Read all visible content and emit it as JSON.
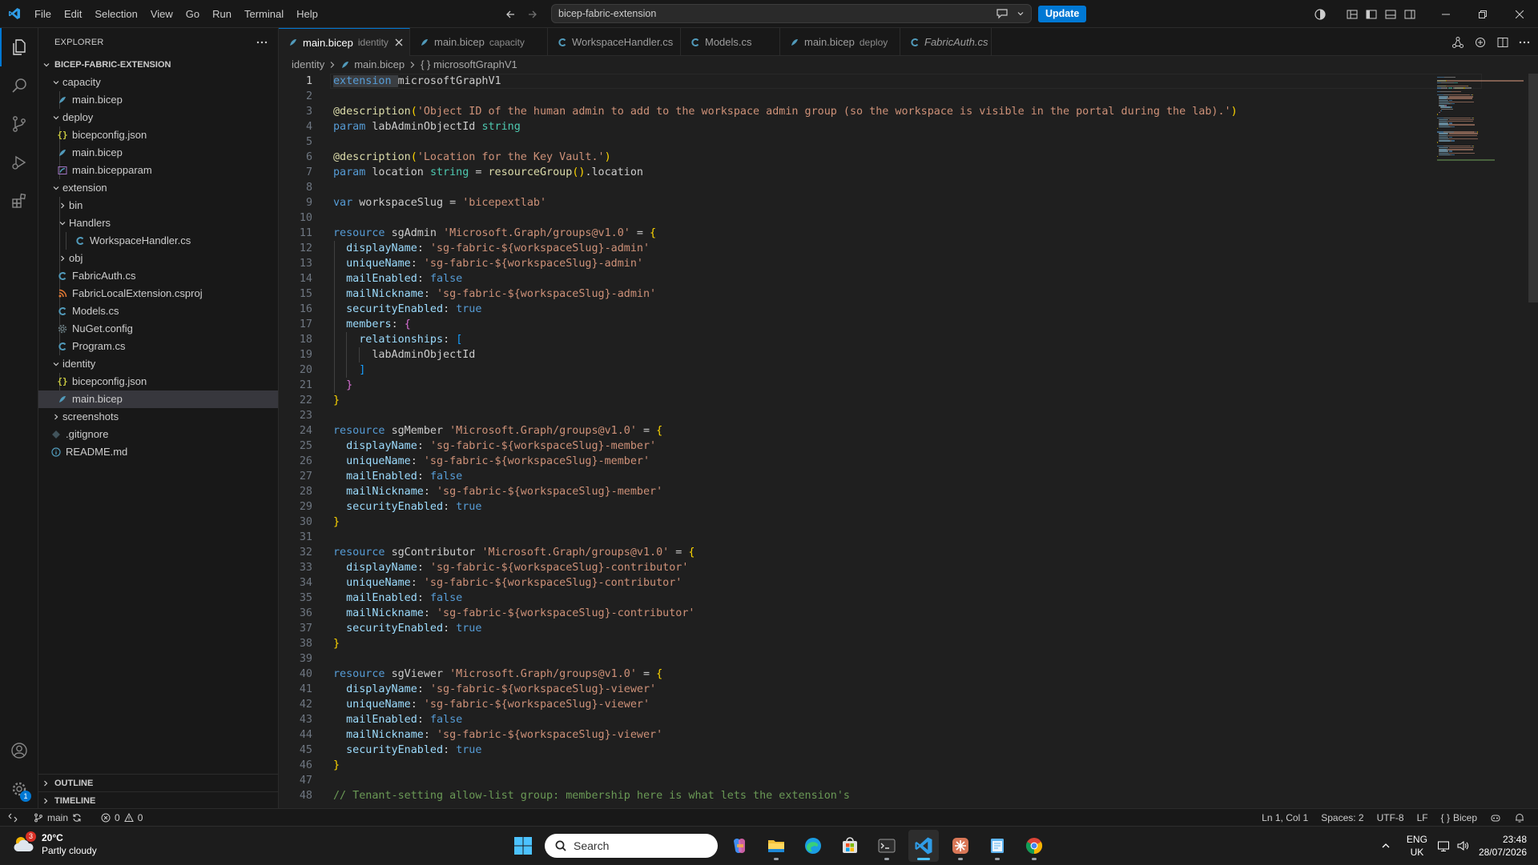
{
  "menu": [
    "File",
    "Edit",
    "Selection",
    "View",
    "Go",
    "Run",
    "Terminal",
    "Help"
  ],
  "command_center": {
    "text": "bicep-fabric-extension"
  },
  "update_label": "Update",
  "explorer": {
    "title": "EXPLORER",
    "root": "BICEP-FABRIC-EXTENSION",
    "items": [
      {
        "label": "capacity",
        "kind": "folder-open"
      },
      {
        "label": "main.bicep",
        "kind": "bicep"
      },
      {
        "label": "deploy",
        "kind": "folder-open"
      },
      {
        "label": "bicepconfig.json",
        "kind": "json"
      },
      {
        "label": "main.bicep",
        "kind": "bicep"
      },
      {
        "label": "main.bicepparam",
        "kind": "bicepparam"
      },
      {
        "label": "extension",
        "kind": "folder-open"
      },
      {
        "label": "bin",
        "kind": "folder-closed"
      },
      {
        "label": "Handlers",
        "kind": "folder-open"
      },
      {
        "label": "WorkspaceHandler.cs",
        "kind": "cs"
      },
      {
        "label": "obj",
        "kind": "folder-closed"
      },
      {
        "label": "FabricAuth.cs",
        "kind": "cs"
      },
      {
        "label": "FabricLocalExtension.csproj",
        "kind": "csproj"
      },
      {
        "label": "Models.cs",
        "kind": "cs"
      },
      {
        "label": "NuGet.config",
        "kind": "config"
      },
      {
        "label": "Program.cs",
        "kind": "cs"
      },
      {
        "label": "identity",
        "kind": "folder-open"
      },
      {
        "label": "bicepconfig.json",
        "kind": "json"
      },
      {
        "label": "main.bicep",
        "kind": "bicep"
      },
      {
        "label": "screenshots",
        "kind": "folder-closed"
      },
      {
        "label": ".gitignore",
        "kind": "gitignore"
      },
      {
        "label": "README.md",
        "kind": "md"
      }
    ],
    "outline": "OUTLINE",
    "timeline": "TIMELINE"
  },
  "tabs": [
    {
      "name": "main.bicep",
      "desc": "identity"
    },
    {
      "name": "main.bicep",
      "desc": "capacity"
    },
    {
      "name": "WorkspaceHandler.cs",
      "desc": ""
    },
    {
      "name": "Models.cs",
      "desc": ""
    },
    {
      "name": "main.bicep",
      "desc": "deploy"
    },
    {
      "name": "FabricAuth.cs",
      "desc": ""
    }
  ],
  "breadcrumb": [
    "identity",
    "main.bicep",
    "{ } microsoftGraphV1"
  ],
  "editor": {
    "current_line": 1,
    "lines": [
      [
        [
          "kw",
          "extension "
        ],
        [
          "plain",
          "microsoftGraphV1"
        ]
      ],
      [],
      [
        [
          "fn",
          "@description"
        ],
        [
          "br1",
          "("
        ],
        [
          "str",
          "'Object ID of the human admin to add to the workspace admin group (so the workspace is visible in the portal during the lab).'"
        ],
        [
          "br1",
          ")"
        ]
      ],
      [
        [
          "kw",
          "param "
        ],
        [
          "plain",
          "labAdminObjectId "
        ],
        [
          "ty",
          "string"
        ]
      ],
      [],
      [
        [
          "fn",
          "@description"
        ],
        [
          "br1",
          "("
        ],
        [
          "str",
          "'Location for the Key Vault.'"
        ],
        [
          "br1",
          ")"
        ]
      ],
      [
        [
          "kw",
          "param "
        ],
        [
          "plain",
          "location "
        ],
        [
          "ty",
          "string"
        ],
        [
          "plain",
          " = "
        ],
        [
          "fn",
          "resourceGroup"
        ],
        [
          "br1",
          "()"
        ],
        [
          "plain",
          ".location"
        ]
      ],
      [],
      [
        [
          "kw",
          "var "
        ],
        [
          "plain",
          "workspaceSlug = "
        ],
        [
          "str",
          "'bicepextlab'"
        ]
      ],
      [],
      [
        [
          "kw",
          "resource "
        ],
        [
          "plain",
          "sgAdmin "
        ],
        [
          "str",
          "'Microsoft.Graph/groups@v1.0'"
        ],
        [
          "plain",
          " = "
        ],
        [
          "br1",
          "{"
        ]
      ],
      [
        [
          "plain",
          "  "
        ],
        [
          "prop",
          "displayName"
        ],
        [
          "plain",
          ": "
        ],
        [
          "str",
          "'sg-fabric-${workspaceSlug}-admin'"
        ]
      ],
      [
        [
          "plain",
          "  "
        ],
        [
          "prop",
          "uniqueName"
        ],
        [
          "plain",
          ": "
        ],
        [
          "str",
          "'sg-fabric-${workspaceSlug}-admin'"
        ]
      ],
      [
        [
          "plain",
          "  "
        ],
        [
          "prop",
          "mailEnabled"
        ],
        [
          "plain",
          ": "
        ],
        [
          "kw",
          "false"
        ]
      ],
      [
        [
          "plain",
          "  "
        ],
        [
          "prop",
          "mailNickname"
        ],
        [
          "plain",
          ": "
        ],
        [
          "str",
          "'sg-fabric-${workspaceSlug}-admin'"
        ]
      ],
      [
        [
          "plain",
          "  "
        ],
        [
          "prop",
          "securityEnabled"
        ],
        [
          "plain",
          ": "
        ],
        [
          "kw",
          "true"
        ]
      ],
      [
        [
          "plain",
          "  "
        ],
        [
          "prop",
          "members"
        ],
        [
          "plain",
          ": "
        ],
        [
          "br2",
          "{"
        ]
      ],
      [
        [
          "plain",
          "    "
        ],
        [
          "prop",
          "relationships"
        ],
        [
          "plain",
          ": "
        ],
        [
          "br3",
          "["
        ]
      ],
      [
        [
          "plain",
          "      labAdminObjectId"
        ]
      ],
      [
        [
          "plain",
          "    "
        ],
        [
          "br3",
          "]"
        ]
      ],
      [
        [
          "plain",
          "  "
        ],
        [
          "br2",
          "}"
        ]
      ],
      [
        [
          "br1",
          "}"
        ]
      ],
      [],
      [
        [
          "kw",
          "resource "
        ],
        [
          "plain",
          "sgMember "
        ],
        [
          "str",
          "'Microsoft.Graph/groups@v1.0'"
        ],
        [
          "plain",
          " = "
        ],
        [
          "br1",
          "{"
        ]
      ],
      [
        [
          "plain",
          "  "
        ],
        [
          "prop",
          "displayName"
        ],
        [
          "plain",
          ": "
        ],
        [
          "str",
          "'sg-fabric-${workspaceSlug}-member'"
        ]
      ],
      [
        [
          "plain",
          "  "
        ],
        [
          "prop",
          "uniqueName"
        ],
        [
          "plain",
          ": "
        ],
        [
          "str",
          "'sg-fabric-${workspaceSlug}-member'"
        ]
      ],
      [
        [
          "plain",
          "  "
        ],
        [
          "prop",
          "mailEnabled"
        ],
        [
          "plain",
          ": "
        ],
        [
          "kw",
          "false"
        ]
      ],
      [
        [
          "plain",
          "  "
        ],
        [
          "prop",
          "mailNickname"
        ],
        [
          "plain",
          ": "
        ],
        [
          "str",
          "'sg-fabric-${workspaceSlug}-member'"
        ]
      ],
      [
        [
          "plain",
          "  "
        ],
        [
          "prop",
          "securityEnabled"
        ],
        [
          "plain",
          ": "
        ],
        [
          "kw",
          "true"
        ]
      ],
      [
        [
          "br1",
          "}"
        ]
      ],
      [],
      [
        [
          "kw",
          "resource "
        ],
        [
          "plain",
          "sgContributor "
        ],
        [
          "str",
          "'Microsoft.Graph/groups@v1.0'"
        ],
        [
          "plain",
          " = "
        ],
        [
          "br1",
          "{"
        ]
      ],
      [
        [
          "plain",
          "  "
        ],
        [
          "prop",
          "displayName"
        ],
        [
          "plain",
          ": "
        ],
        [
          "str",
          "'sg-fabric-${workspaceSlug}-contributor'"
        ]
      ],
      [
        [
          "plain",
          "  "
        ],
        [
          "prop",
          "uniqueName"
        ],
        [
          "plain",
          ": "
        ],
        [
          "str",
          "'sg-fabric-${workspaceSlug}-contributor'"
        ]
      ],
      [
        [
          "plain",
          "  "
        ],
        [
          "prop",
          "mailEnabled"
        ],
        [
          "plain",
          ": "
        ],
        [
          "kw",
          "false"
        ]
      ],
      [
        [
          "plain",
          "  "
        ],
        [
          "prop",
          "mailNickname"
        ],
        [
          "plain",
          ": "
        ],
        [
          "str",
          "'sg-fabric-${workspaceSlug}-contributor'"
        ]
      ],
      [
        [
          "plain",
          "  "
        ],
        [
          "prop",
          "securityEnabled"
        ],
        [
          "plain",
          ": "
        ],
        [
          "kw",
          "true"
        ]
      ],
      [
        [
          "br1",
          "}"
        ]
      ],
      [],
      [
        [
          "kw",
          "resource "
        ],
        [
          "plain",
          "sgViewer "
        ],
        [
          "str",
          "'Microsoft.Graph/groups@v1.0'"
        ],
        [
          "plain",
          " = "
        ],
        [
          "br1",
          "{"
        ]
      ],
      [
        [
          "plain",
          "  "
        ],
        [
          "prop",
          "displayName"
        ],
        [
          "plain",
          ": "
        ],
        [
          "str",
          "'sg-fabric-${workspaceSlug}-viewer'"
        ]
      ],
      [
        [
          "plain",
          "  "
        ],
        [
          "prop",
          "uniqueName"
        ],
        [
          "plain",
          ": "
        ],
        [
          "str",
          "'sg-fabric-${workspaceSlug}-viewer'"
        ]
      ],
      [
        [
          "plain",
          "  "
        ],
        [
          "prop",
          "mailEnabled"
        ],
        [
          "plain",
          ": "
        ],
        [
          "kw",
          "false"
        ]
      ],
      [
        [
          "plain",
          "  "
        ],
        [
          "prop",
          "mailNickname"
        ],
        [
          "plain",
          ": "
        ],
        [
          "str",
          "'sg-fabric-${workspaceSlug}-viewer'"
        ]
      ],
      [
        [
          "plain",
          "  "
        ],
        [
          "prop",
          "securityEnabled"
        ],
        [
          "plain",
          ": "
        ],
        [
          "kw",
          "true"
        ]
      ],
      [
        [
          "br1",
          "}"
        ]
      ],
      [],
      [
        [
          "cm",
          "// Tenant-setting allow-list group: membership here is what lets the extension's"
        ]
      ]
    ]
  },
  "status": {
    "branch": "main",
    "errors": "0",
    "warnings": "0",
    "position": "Ln 1, Col 1",
    "spaces": "Spaces: 2",
    "encoding": "UTF-8",
    "eol": "LF",
    "language": "Bicep",
    "language_icon": "{ }"
  },
  "taskbar": {
    "weather_temp": "20°C",
    "weather_desc": "Partly cloudy",
    "weather_badge": "3",
    "search_placeholder": "Search",
    "lang_top": "ENG",
    "lang_bottom": "UK",
    "time": "23:48",
    "date": "28/07/2026"
  },
  "accounts_badge": "1",
  "colors": {
    "accent": "#0078d4",
    "background": "#1f1f1f",
    "sidebar": "#181818"
  }
}
